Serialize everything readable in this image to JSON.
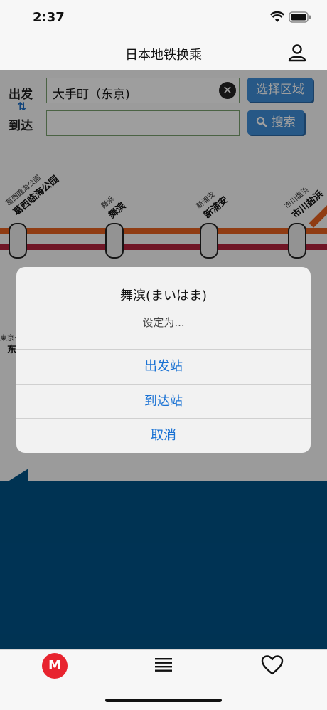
{
  "status_bar": {
    "time": "2:37"
  },
  "nav": {
    "title": "日本地铁换乘"
  },
  "search": {
    "from_label": "出发",
    "to_label": "到达",
    "swap_icon": "⇅",
    "from_value": "大手町（东京)",
    "to_value": "",
    "clear_icon": "✕",
    "region_button": "选择区域",
    "search_button": "搜索",
    "search_icon": "magnifier-icon"
  },
  "map": {
    "stations": [
      {
        "small": "葛西臨海公園",
        "big": "葛西临海公园"
      },
      {
        "small": "舞浜",
        "big": "舞滨"
      },
      {
        "small": "新浦安",
        "big": "新浦安"
      },
      {
        "small": "市川塩浜",
        "big": "市川盐浜"
      }
    ],
    "side_station_small": "東京テ",
    "side_station_big": "东",
    "line_colors": {
      "orange": "#e8621f",
      "red": "#b5243e",
      "blue": "#005387"
    }
  },
  "dialog": {
    "title": "舞滨(まいはま)",
    "message": "设定为...",
    "actions": [
      "出发站",
      "到达站",
      "取消"
    ]
  },
  "tabbar": {
    "metro_label": "M",
    "list_icon": "list-icon",
    "favorite_icon": "heart-icon"
  }
}
